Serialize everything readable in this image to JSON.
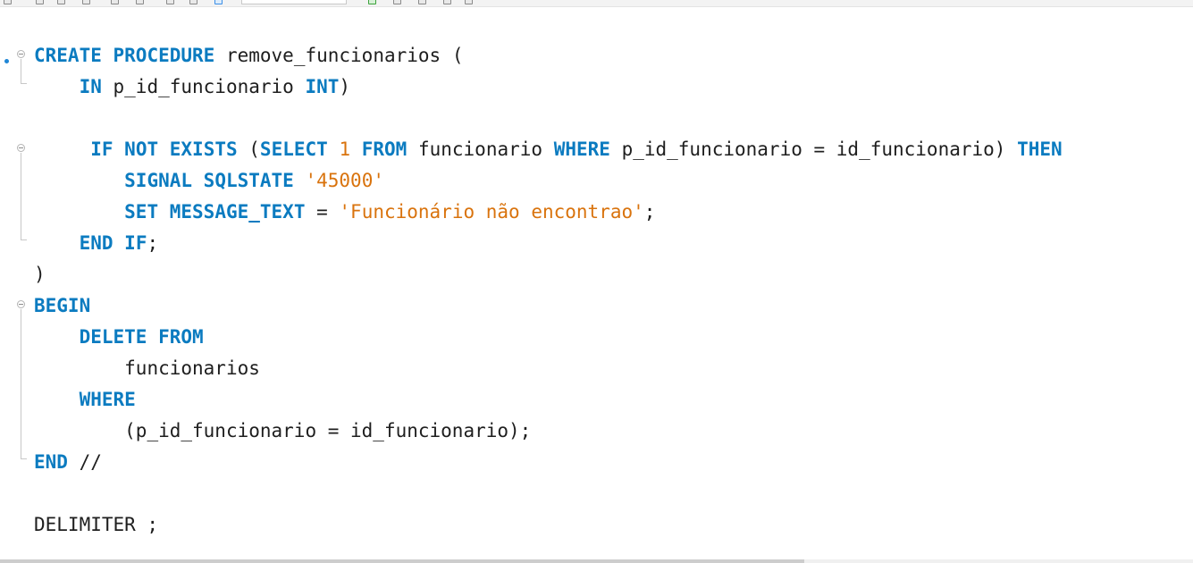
{
  "toolbar": {
    "icons": [
      "new-file-icon",
      "open-folder-icon",
      "save-icon",
      "save-as-icon",
      "run-icon",
      "stop-icon",
      "format-icon",
      "search-icon",
      "wrap-icon",
      "execute-icon",
      "comment-icon",
      "uncomment-icon",
      "beautify-icon"
    ]
  },
  "editor": {
    "colors": {
      "keyword": "#0b7bc0",
      "string": "#d9730d",
      "number": "#d9730d",
      "text": "#1e1e1e"
    },
    "lines": [
      {
        "indent": "",
        "tokens": [
          {
            "t": "CREATE",
            "k": "kw"
          },
          {
            "t": " ",
            "k": ""
          },
          {
            "t": "PROCEDURE",
            "k": "kw"
          },
          {
            "t": " remove_funcionarios (",
            "k": ""
          }
        ]
      },
      {
        "indent": "    ",
        "tokens": [
          {
            "t": "IN",
            "k": "kw"
          },
          {
            "t": " p_id_funcionario ",
            "k": ""
          },
          {
            "t": "INT",
            "k": "kw"
          },
          {
            "t": ")",
            "k": ""
          }
        ]
      },
      {
        "indent": "",
        "tokens": []
      },
      {
        "indent": "     ",
        "tokens": [
          {
            "t": "IF",
            "k": "kw"
          },
          {
            "t": " ",
            "k": ""
          },
          {
            "t": "NOT",
            "k": "kw"
          },
          {
            "t": " ",
            "k": ""
          },
          {
            "t": "EXISTS",
            "k": "kw"
          },
          {
            "t": " (",
            "k": ""
          },
          {
            "t": "SELECT",
            "k": "kw"
          },
          {
            "t": " ",
            "k": ""
          },
          {
            "t": "1",
            "k": "num"
          },
          {
            "t": " ",
            "k": ""
          },
          {
            "t": "FROM",
            "k": "kw"
          },
          {
            "t": " funcionario ",
            "k": ""
          },
          {
            "t": "WHERE",
            "k": "kw"
          },
          {
            "t": " p_id_funcionario = id_funcionario) ",
            "k": ""
          },
          {
            "t": "THEN",
            "k": "kw"
          }
        ]
      },
      {
        "indent": "        ",
        "tokens": [
          {
            "t": "SIGNAL",
            "k": "kw"
          },
          {
            "t": " ",
            "k": ""
          },
          {
            "t": "SQLSTATE",
            "k": "kw"
          },
          {
            "t": " ",
            "k": ""
          },
          {
            "t": "'45000'",
            "k": "str"
          }
        ]
      },
      {
        "indent": "        ",
        "tokens": [
          {
            "t": "SET",
            "k": "kw"
          },
          {
            "t": " ",
            "k": ""
          },
          {
            "t": "MESSAGE_TEXT",
            "k": "kw"
          },
          {
            "t": " = ",
            "k": ""
          },
          {
            "t": "'Funcionário não encontrao'",
            "k": "str"
          },
          {
            "t": ";",
            "k": ""
          }
        ]
      },
      {
        "indent": "    ",
        "tokens": [
          {
            "t": "END",
            "k": "kw"
          },
          {
            "t": " ",
            "k": ""
          },
          {
            "t": "IF",
            "k": "kw"
          },
          {
            "t": ";",
            "k": ""
          }
        ]
      },
      {
        "indent": "",
        "tokens": [
          {
            "t": ")",
            "k": ""
          }
        ]
      },
      {
        "indent": "",
        "tokens": [
          {
            "t": "BEGIN",
            "k": "kw"
          }
        ]
      },
      {
        "indent": "    ",
        "tokens": [
          {
            "t": "DELETE",
            "k": "kw"
          },
          {
            "t": " ",
            "k": ""
          },
          {
            "t": "FROM",
            "k": "kw"
          }
        ]
      },
      {
        "indent": "        ",
        "tokens": [
          {
            "t": "funcionarios",
            "k": ""
          }
        ]
      },
      {
        "indent": "    ",
        "tokens": [
          {
            "t": "WHERE",
            "k": "kw"
          }
        ]
      },
      {
        "indent": "        ",
        "tokens": [
          {
            "t": "(p_id_funcionario = id_funcionario);",
            "k": ""
          }
        ]
      },
      {
        "indent": "",
        "tokens": [
          {
            "t": "END",
            "k": "kw"
          },
          {
            "t": " //",
            "k": ""
          }
        ]
      },
      {
        "indent": "",
        "tokens": []
      },
      {
        "indent": "",
        "tokens": [
          {
            "t": "DELIMITER ;",
            "k": ""
          }
        ]
      }
    ]
  }
}
